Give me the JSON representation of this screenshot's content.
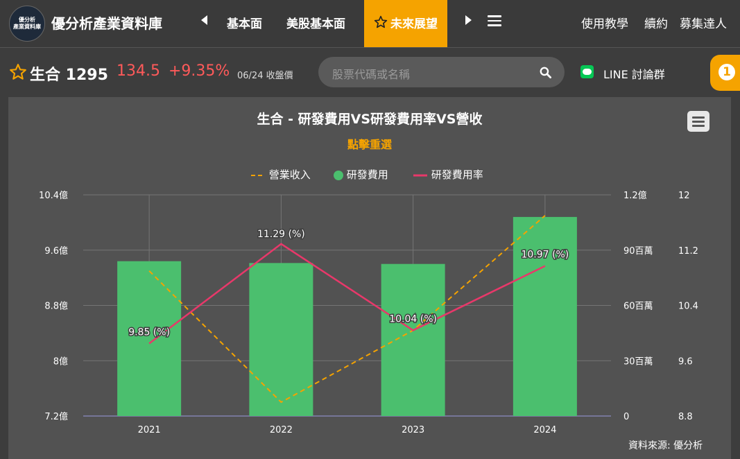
{
  "nav": {
    "logo_line1": "優分析",
    "logo_line2": "產業資料庫",
    "brand": "優分析產業資料庫",
    "items": [
      "基本面",
      "美股基本面"
    ],
    "active": "未來展望",
    "right_links": [
      "使用教學",
      "續約",
      "募集達人"
    ]
  },
  "stock": {
    "name": "生合 1295",
    "price": "134.5",
    "change": "+9.35%",
    "date": "06/24 收盤價"
  },
  "search": {
    "placeholder": "股票代碼或名稱"
  },
  "line_group": "LINE 討論群",
  "notification_count": "1",
  "colors": {
    "accent": "#f5a300",
    "up": "#ff5a5a",
    "bar": "#4bbf6e",
    "rate_line": "#e8386a",
    "revenue_line": "#f5a300"
  },
  "chart_data": {
    "type": "bar",
    "title": "生合 - 研發費用VS研發費用率VS營收",
    "subtitle": "點擊重選",
    "categories": [
      "2021",
      "2022",
      "2023",
      "2024"
    ],
    "legend": [
      "營業收入",
      "研發費用",
      "研發費用率"
    ],
    "series": [
      {
        "name": "營業收入",
        "type": "line-dashed",
        "axis": "left",
        "unit": "億",
        "values": [
          9.3,
          7.4,
          8.44,
          10.1
        ]
      },
      {
        "name": "研發費用",
        "type": "bar",
        "axis": "right1",
        "unit": "百萬",
        "values": [
          84,
          83,
          82.5,
          108
        ]
      },
      {
        "name": "研發費用率",
        "type": "line",
        "axis": "right2",
        "unit": "%",
        "values": [
          9.85,
          11.29,
          10.04,
          10.97
        ],
        "labels": [
          "9.85 (%)",
          "11.29 (%)",
          "10.04 (%)",
          "10.97 (%)"
        ]
      }
    ],
    "axes": {
      "left": {
        "range": [
          7.2,
          10.4
        ],
        "ticks": [
          "7.2億",
          "8億",
          "8.8億",
          "9.6億",
          "10.4億"
        ]
      },
      "right1": {
        "range": [
          0,
          120
        ],
        "ticks": [
          "0",
          "30百萬",
          "60百萬",
          "90百萬",
          "1.2億"
        ]
      },
      "right2": {
        "range": [
          8.8,
          12
        ],
        "ticks": [
          "8.8",
          "9.6",
          "10.4",
          "11.2",
          "12"
        ]
      }
    },
    "grid": true,
    "legend_position": "top-center",
    "source": "資料來源: 優分析"
  }
}
